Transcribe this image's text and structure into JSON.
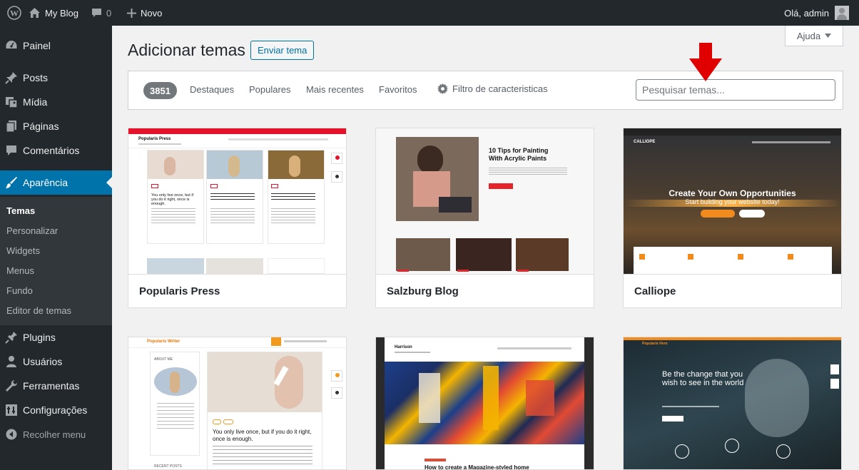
{
  "adminbar": {
    "site_name": "My Blog",
    "comments_count": "0",
    "new_label": "Novo",
    "greeting": "Olá, admin"
  },
  "sidebar": {
    "items": [
      {
        "label": "Painel",
        "icon": "dashboard-icon"
      },
      {
        "label": "Posts",
        "icon": "pin-icon"
      },
      {
        "label": "Mídia",
        "icon": "media-icon"
      },
      {
        "label": "Páginas",
        "icon": "page-icon"
      },
      {
        "label": "Comentários",
        "icon": "comment-icon"
      },
      {
        "label": "Aparência",
        "icon": "brush-icon"
      },
      {
        "label": "Plugins",
        "icon": "plugin-icon"
      },
      {
        "label": "Usuários",
        "icon": "user-icon"
      },
      {
        "label": "Ferramentas",
        "icon": "wrench-icon"
      },
      {
        "label": "Configurações",
        "icon": "settings-icon"
      }
    ],
    "submenu": [
      "Temas",
      "Personalizar",
      "Widgets",
      "Menus",
      "Fundo",
      "Editor de temas"
    ],
    "collapse_label": "Recolher menu"
  },
  "header": {
    "title": "Adicionar temas",
    "upload_button": "Enviar tema",
    "help_label": "Ajuda"
  },
  "filter": {
    "count": "3851",
    "links": [
      "Destaques",
      "Populares",
      "Mais recentes",
      "Favoritos"
    ],
    "feature_filter": "Filtro de caracteristicas",
    "search_placeholder": "Pesquisar temas..."
  },
  "themes": [
    {
      "name": "Popularis Press"
    },
    {
      "name": "Salzburg Blog"
    },
    {
      "name": "Calliope"
    }
  ],
  "previews": {
    "popularis_press_title": "Popularis Press",
    "salzburg_heading": "10 Tips for Painting With Acrylic Paints",
    "calliope_headline": "Create Your Own Opportunities",
    "calliope_sub": "Start building your website today!",
    "calliope_logo": "CALLIOPE",
    "popularis_writer_title": "Popularis Writer",
    "popularis_writer_post": "You only live once, but if you do it right, once is enough.",
    "popularis_press_post": "You only live once, but if you do it right, once is enough.",
    "harrison_title": "Harrison",
    "harrison_post": "How to create a Magazine-styled home",
    "popularis_hero_sub": "Popularis Hero",
    "hero_text": "Be the change that you wish to see in the world",
    "about_label": "ABOUT ME",
    "recent_label": "RECENT POSTS"
  },
  "colors": {
    "admin_bg": "#23282d",
    "accent": "#0073aa",
    "arrow": "#e00000"
  }
}
